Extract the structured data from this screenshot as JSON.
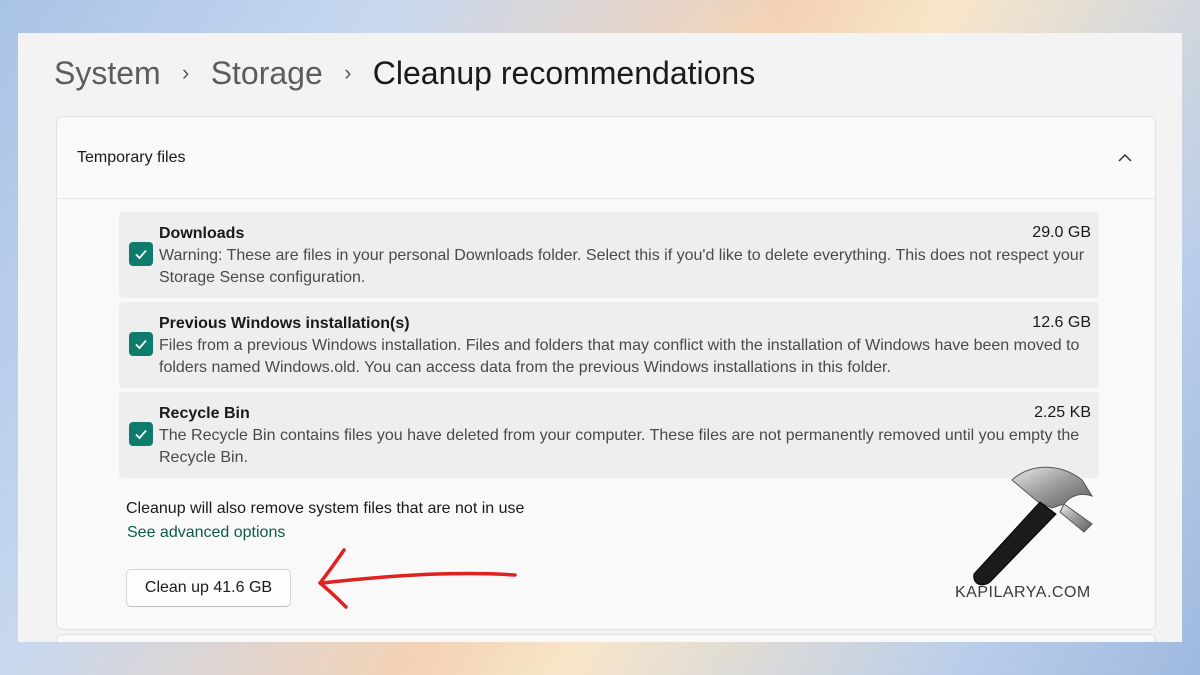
{
  "breadcrumb": {
    "item1": "System",
    "item2": "Storage",
    "current": "Cleanup recommendations",
    "separator": "›"
  },
  "section": {
    "title": "Temporary files"
  },
  "items": [
    {
      "title": "Downloads",
      "size": "29.0 GB",
      "description": "Warning: These are files in your personal Downloads folder. Select this if you'd like to delete everything. This does not respect your Storage Sense configuration.",
      "checked": true
    },
    {
      "title": "Previous Windows installation(s)",
      "size": "12.6 GB",
      "description": "Files from a previous Windows installation.  Files and folders that may conflict with the installation of Windows have been moved to folders named Windows.old.  You can access data from the previous Windows installations in this folder.",
      "checked": true
    },
    {
      "title": "Recycle Bin",
      "size": "2.25 KB",
      "description": "The Recycle Bin contains files you have deleted from your computer. These files are not permanently removed until you empty the Recycle Bin.",
      "checked": true
    }
  ],
  "note": "Cleanup will also remove system files that are not in use",
  "link": "See advanced options",
  "button": "Clean up 41.6 GB",
  "watermark": "KAPILARYA.COM",
  "colors": {
    "accent": "#0f7b6c",
    "link": "#0e5b4a",
    "arrow": "#e0211d"
  }
}
